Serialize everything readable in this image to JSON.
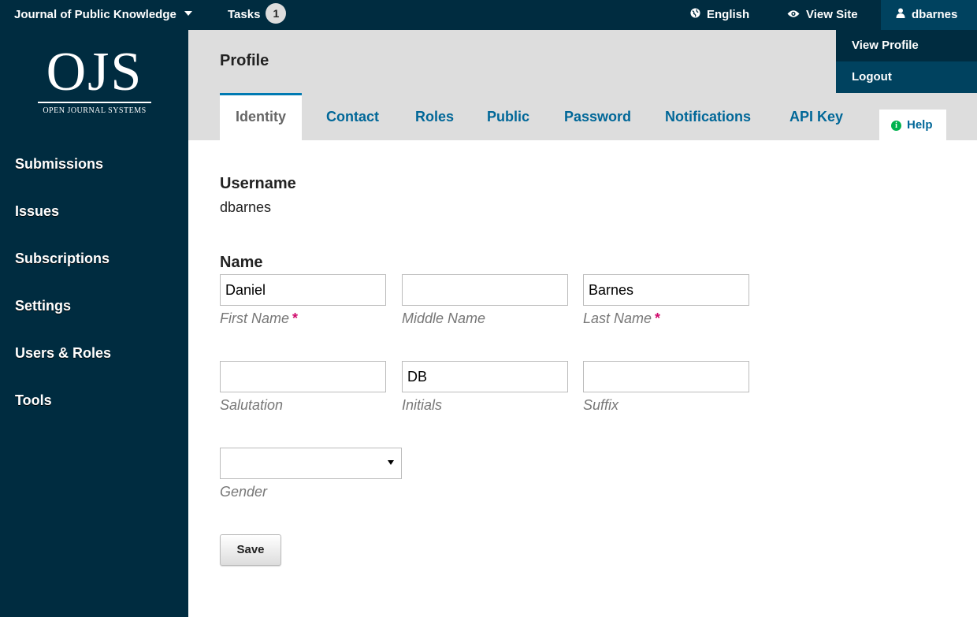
{
  "topbar": {
    "journal_name": "Journal of Public Knowledge",
    "tasks_label": "Tasks",
    "tasks_count": "1",
    "language": "English",
    "view_site": "View Site",
    "username": "dbarnes"
  },
  "user_menu": {
    "view_profile": "View Profile",
    "logout": "Logout"
  },
  "logo": {
    "mark": "OJS",
    "subtitle": "OPEN JOURNAL SYSTEMS"
  },
  "sidebar": {
    "items": [
      {
        "label": "Submissions"
      },
      {
        "label": "Issues"
      },
      {
        "label": "Subscriptions"
      },
      {
        "label": "Settings"
      },
      {
        "label": "Users & Roles"
      },
      {
        "label": "Tools"
      }
    ]
  },
  "header": {
    "title": "Profile",
    "tabs": [
      {
        "label": "Identity",
        "active": true
      },
      {
        "label": "Contact"
      },
      {
        "label": "Roles"
      },
      {
        "label": "Public"
      },
      {
        "label": "Password"
      },
      {
        "label": "Notifications"
      },
      {
        "label": "API Key"
      }
    ],
    "help": "Help"
  },
  "form": {
    "username_heading": "Username",
    "username_value": "dbarnes",
    "name_heading": "Name",
    "first_name": {
      "value": "Daniel",
      "label": "First Name",
      "required": "*"
    },
    "middle_name": {
      "value": "",
      "label": "Middle Name"
    },
    "last_name": {
      "value": "Barnes",
      "label": "Last Name",
      "required": "*"
    },
    "salutation": {
      "value": "",
      "label": "Salutation"
    },
    "initials": {
      "value": "DB",
      "label": "Initials"
    },
    "suffix": {
      "value": "",
      "label": "Suffix"
    },
    "gender": {
      "value": "",
      "label": "Gender"
    },
    "save": "Save"
  },
  "colors": {
    "nav_dark": "#002c40",
    "nav_active": "#00425f",
    "link_blue": "#006798",
    "required_pink": "#d00a6c",
    "help_green": "#00b24e"
  },
  "icons": {
    "language": "globe-icon",
    "view_site": "eye-icon",
    "user": "user-icon",
    "help": "info-circle-icon"
  }
}
